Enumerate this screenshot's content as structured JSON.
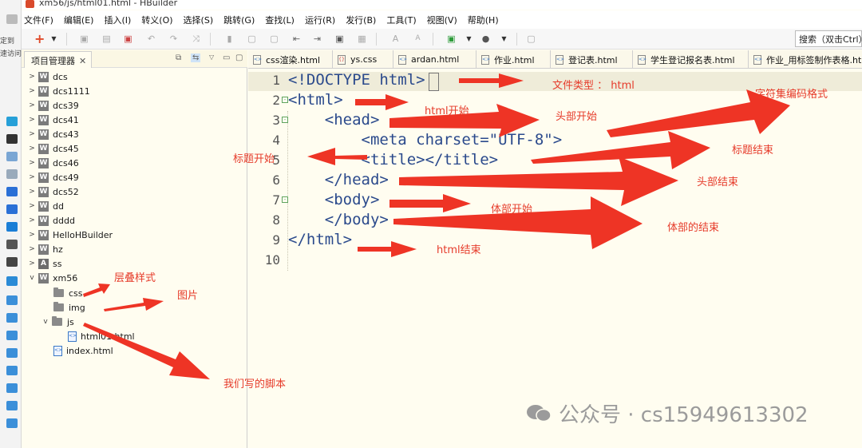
{
  "window": {
    "title": "xm56/js/html01.html  -  HBuilder"
  },
  "left_strip": {
    "texts": [
      "定到",
      "速访问"
    ]
  },
  "menu": [
    "文件(F)",
    "编辑(E)",
    "插入(I)",
    "转义(O)",
    "选择(S)",
    "跳转(G)",
    "查找(L)",
    "运行(R)",
    "发行(B)",
    "工具(T)",
    "视图(V)",
    "帮助(H)"
  ],
  "toolbar": {
    "search_text": "搜索（双击Ctrl）"
  },
  "project_panel": {
    "tab_label": "项目管理器",
    "close": "✕",
    "items": [
      {
        "label": "dcs",
        "icon": "W"
      },
      {
        "label": "dcs1111",
        "icon": "W"
      },
      {
        "label": "dcs39",
        "icon": "W"
      },
      {
        "label": "dcs41",
        "icon": "W"
      },
      {
        "label": "dcs43",
        "icon": "W"
      },
      {
        "label": "dcs45",
        "icon": "W"
      },
      {
        "label": "dcs46",
        "icon": "W"
      },
      {
        "label": "dcs49",
        "icon": "W"
      },
      {
        "label": "dcs52",
        "icon": "W"
      },
      {
        "label": "dd",
        "icon": "W"
      },
      {
        "label": "dddd",
        "icon": "W"
      },
      {
        "label": "HelloHBuilder",
        "icon": "W"
      },
      {
        "label": "hz",
        "icon": "W"
      },
      {
        "label": "ss",
        "icon": "A"
      },
      {
        "label": "xm56",
        "icon": "W"
      },
      {
        "label": "css",
        "icon": "folder"
      },
      {
        "label": "img",
        "icon": "folder"
      },
      {
        "label": "js",
        "icon": "folder"
      },
      {
        "label": "html01.html",
        "icon": "html"
      },
      {
        "label": "index.html",
        "icon": "html"
      }
    ]
  },
  "editor_tabs": [
    "css渲染.html",
    "ys.css",
    "ardan.html",
    "作业.html",
    "登记表.html",
    "学生登记报名表.html",
    "作业_用标签制作表格.html"
  ],
  "code_lines": [
    {
      "n": "1",
      "text": "<!DOCTYPE html>"
    },
    {
      "n": "2",
      "text": "<html>"
    },
    {
      "n": "3",
      "text": "    <head>"
    },
    {
      "n": "4",
      "text": "        <meta charset=\"UTF-8\">"
    },
    {
      "n": "5",
      "text": "        <title></title>"
    },
    {
      "n": "6",
      "text": "    </head>"
    },
    {
      "n": "7",
      "text": "    <body>"
    },
    {
      "n": "8",
      "text": "    </body>"
    },
    {
      "n": "9",
      "text": "</html>"
    },
    {
      "n": "10",
      "text": ""
    }
  ],
  "annotations": {
    "doctype": "文件类型 ： html",
    "charset": "字符集编码格式",
    "html_start": "html开始",
    "head_start": "头部开始",
    "title_end": "标题结束",
    "title_start": "标题开始",
    "head_end": "头部结束",
    "body_start": "体部开始",
    "body_end": "体部的结束",
    "html_end": "html结束",
    "css": "层叠样式",
    "img": "图片",
    "js": "我们写的脚本"
  },
  "watermark": "公众号 · cs15949613302",
  "colors": {
    "annotation": "#e63b2a",
    "editor_bg": "#fffdf0"
  }
}
